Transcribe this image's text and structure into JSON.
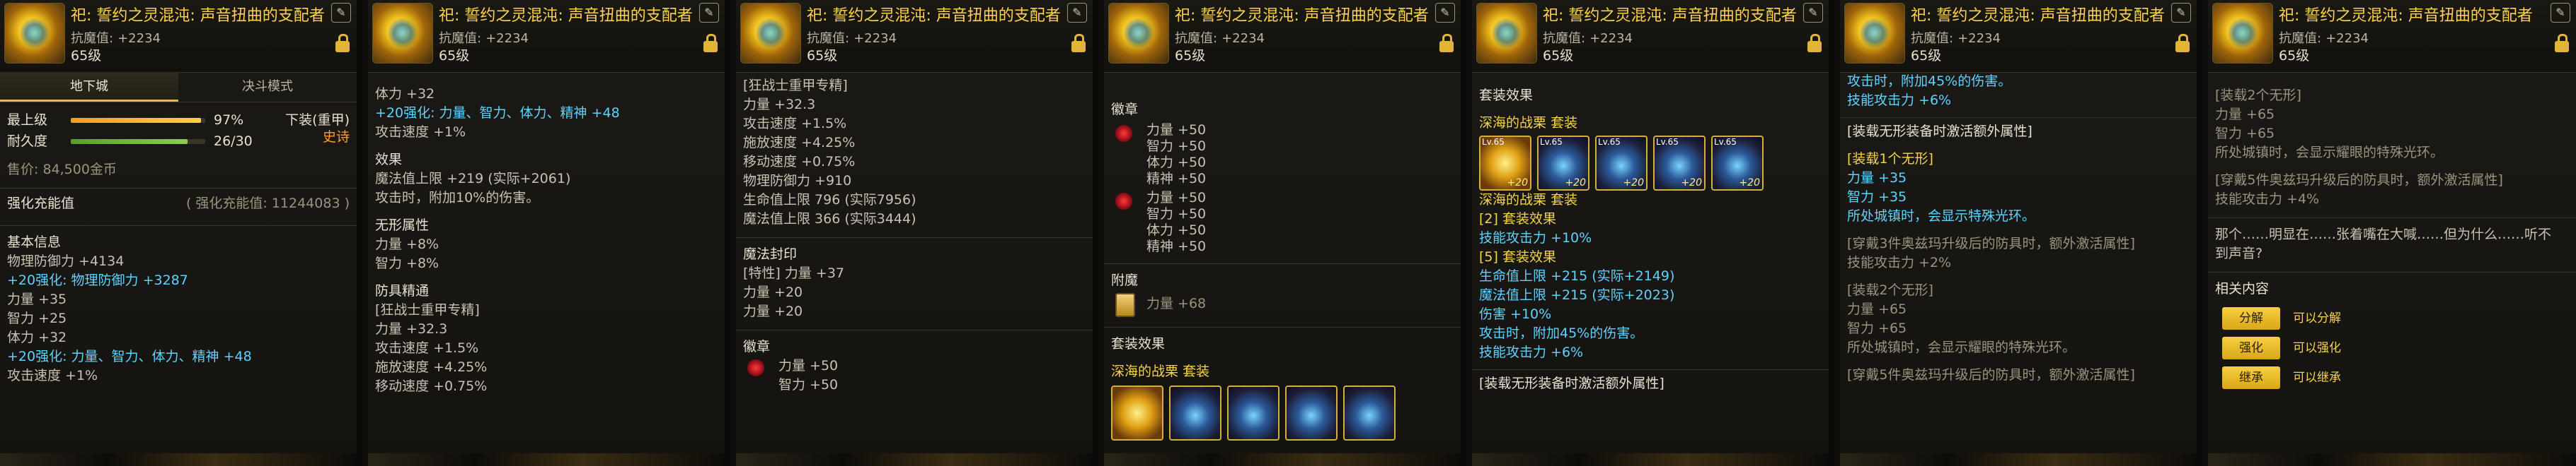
{
  "header": {
    "item_name": "祀: 誓约之灵混沌: 声音扭曲的支配者",
    "resist_label": "抗魔值:",
    "resist_value": "+2234",
    "level": "65级"
  },
  "panel1": {
    "tabs": [
      "地下城",
      "决斗模式"
    ],
    "max_label": "最上级",
    "max_pct": "97%",
    "max_fill": 0.97,
    "dur_label": "耐久度",
    "dur_value": "26/30",
    "dur_fill": 0.8667,
    "slot_label": "下装(重甲)",
    "rarity": "史诗",
    "price": "售价: 84,500金币",
    "amp_label": "强化充能值",
    "amp_value": "( 强化充能值: 11244083 )",
    "basic_title": "基本信息",
    "phys_def": "物理防御力 +4134",
    "phys_def_bonus": "+20强化: 物理防御力 +3287",
    "str": "力量 +35",
    "int": "智力 +25",
    "vit": "体力 +32",
    "bonus_stats": "+20强化: 力量、智力、体力、精神 +48",
    "atk_speed": "攻击速度 +1%"
  },
  "panel2": {
    "vit": "体力 +32",
    "bonus_stats": "+20强化: 力量、智力、体力、精神 +48",
    "atk_speed": "攻击速度 +1%",
    "effect_title": "效果",
    "mp_max": "魔法值上限 +219 (实际+2061)",
    "attack_dmg": "攻击时，附加10%的伤害。",
    "nonform_title": "无形属性",
    "str": "力量 +8%",
    "int": "智力 +8%",
    "armor_title": "防具精通",
    "armor_spec": "[狂战士重甲专精]",
    "spec_str": "力量 +32.3",
    "spec_atk": "攻击速度 +1.5%",
    "spec_cast": "施放速度 +4.25%",
    "spec_move": "移动速度 +0.75%"
  },
  "panel3": {
    "armor_spec": "[狂战士重甲专精]",
    "lines": [
      "力量 +32.3",
      "攻击速度 +1.5%",
      "施放速度 +4.25%",
      "移动速度 +0.75%",
      "物理防御力 +910",
      "生命值上限 796 (实际7956)",
      "魔法值上限 366 (实际3444)"
    ],
    "seal_title": "魔法封印",
    "seal_lines": [
      "[特性] 力量 +37",
      "力量 +20",
      "力量 +20"
    ],
    "badge_title": "徽章",
    "badge_lines": [
      "力量 +50",
      "智力 +50"
    ]
  },
  "panel4": {
    "badge_title": "徽章",
    "badge_group1": [
      "力量 +50",
      "智力 +50",
      "体力 +50",
      "精神 +50"
    ],
    "badge_group2": [
      "力量 +50",
      "智力 +50",
      "体力 +50",
      "精神 +50"
    ],
    "enchant_title": "附魔",
    "enchant_value": "力量 +68",
    "set_title": "套装效果",
    "set_name": "深海的战栗",
    "set_tag": "套装"
  },
  "panel5": {
    "set_title": "套装效果",
    "set_name": "深海的战栗",
    "set_tag": "套装",
    "set_items": [
      "Lv.65",
      "Lv.65",
      "Lv.65",
      "Lv.65",
      "Lv.65"
    ],
    "set_items_enh": [
      "+20",
      "+20",
      "+20",
      "+20",
      "+20"
    ],
    "set_name2": "深海的战栗",
    "set_tag2": "套装",
    "set2_label": "[2] 套装效果",
    "set2_bonus": "技能攻击力 +10%",
    "set5_label": "[5] 套装效果",
    "set5_hp": "生命值上限 +215 (实际+2149)",
    "set5_mp": "魔法值上限 +215 (实际+2023)",
    "dmg": "伤害 +10%",
    "attack_add": "攻击时，附加45%的伤害。",
    "skill_atk": "技能攻击力 +6%",
    "extra_title": "[装载无形装备时激活额外属性]"
  },
  "panel6": {
    "attack_add": "攻击时，附加45%的伤害。",
    "skill_atk": "技能攻击力 +6%",
    "extra_title": "[装载无形装备时激活额外属性]",
    "one_form": "[装载1个无形]",
    "one_str": "力量 +35",
    "one_int": "智力 +35",
    "one_ring": "所处城镇时，会显示特殊光环。",
    "wear3": "[穿戴3件奥兹玛升级后的防具时，额外激活属性]",
    "wear3_bonus": "技能攻击力 +2%",
    "two_form": "[装载2个无形]",
    "two_str": "力量 +65",
    "two_int": "智力 +65",
    "two_ring": "所处城镇时，会显示耀眼的特殊光环。",
    "wear5_cut": "[穿戴5件奥兹玛升级后的防具时，额外激活属性]"
  },
  "panel7": {
    "two_form": "[装载2个无形]",
    "two_str": "力量 +65",
    "two_int": "智力 +65",
    "two_ring": "所处城镇时，会显示耀眼的特殊光环。",
    "wear5": "[穿戴5件奥兹玛升级后的防具时，额外激活属性]",
    "wear5_bonus": "技能攻击力 +4%",
    "flavor1": "那个……明显在……张着嘴在大喊……但为什么……听不",
    "flavor2": "到声音?",
    "related_title": "相关内容",
    "buttons": [
      {
        "label": "分解",
        "desc": "可以分解"
      },
      {
        "label": "强化",
        "desc": "可以强化"
      },
      {
        "label": "继承",
        "desc": "可以继承"
      }
    ]
  }
}
